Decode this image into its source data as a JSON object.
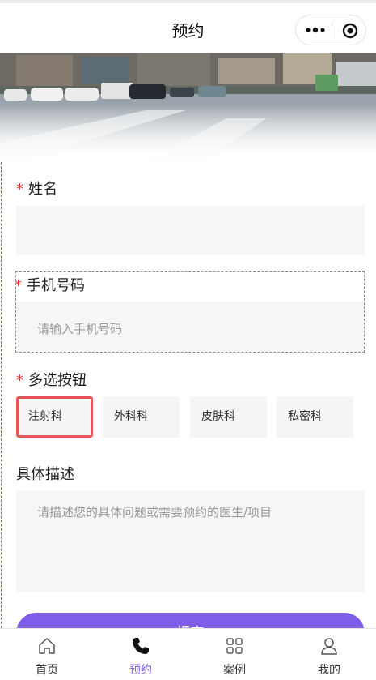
{
  "header": {
    "title": "预约",
    "menu_icon": "more-dots-icon",
    "close_icon": "target-circle-icon"
  },
  "banner": {
    "description_icon": "street-photo"
  },
  "form": {
    "name": {
      "label": "姓名",
      "required_mark": "*",
      "value": ""
    },
    "phone": {
      "label": "手机号码",
      "required_mark": "*",
      "placeholder": "请输入手机号码"
    },
    "multi": {
      "label": "多选按钮",
      "required_mark": "*",
      "options": [
        "注射科",
        "外科科",
        "皮肤科",
        "私密科"
      ],
      "selected": "注射科"
    },
    "desc": {
      "label": "具体描述",
      "placeholder": "请描述您的具体问题或需要预约的医生/项目"
    },
    "submit_label": "提交"
  },
  "tabbar": {
    "items": [
      {
        "label": "首页",
        "icon": "home-icon"
      },
      {
        "label": "预约",
        "icon": "phone-icon"
      },
      {
        "label": "案例",
        "icon": "grid-icon"
      },
      {
        "label": "我的",
        "icon": "user-icon"
      }
    ],
    "active": "预约",
    "accent": "#7e5ee9"
  }
}
